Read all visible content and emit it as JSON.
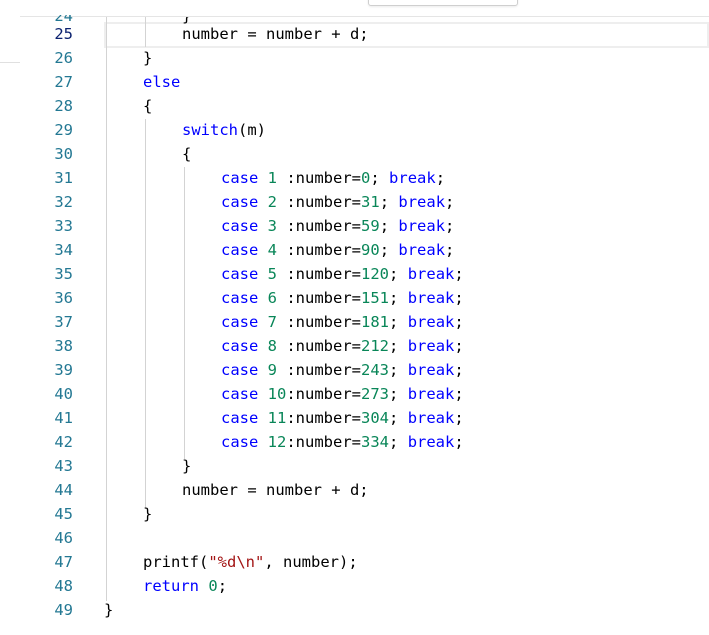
{
  "editor": {
    "line_numbers": [
      "25",
      "26",
      "27",
      "28",
      "29",
      "30",
      "31",
      "32",
      "33",
      "34",
      "35",
      "36",
      "37",
      "38",
      "39",
      "40",
      "41",
      "42",
      "43",
      "44",
      "45",
      "46",
      "47",
      "48",
      "49"
    ],
    "active_line": "25",
    "partial_top": {
      "line_number": "24",
      "brace": "}"
    },
    "code": {
      "l25": "number = number + d;",
      "l26": "}",
      "l27_kw": "else",
      "l28": "{",
      "l29_kw": "switch",
      "l29_rest": "(m)",
      "l30": "{",
      "cases": [
        {
          "kw": "case",
          "num": "1",
          "sep": " :number=",
          "val": "0",
          "end": ";",
          "brk": "break",
          "semi": ";"
        },
        {
          "kw": "case",
          "num": "2",
          "sep": " :number=",
          "val": "31",
          "end": ";",
          "brk": "break",
          "semi": ";"
        },
        {
          "kw": "case",
          "num": "3",
          "sep": " :number=",
          "val": "59",
          "end": ";",
          "brk": "break",
          "semi": ";"
        },
        {
          "kw": "case",
          "num": "4",
          "sep": " :number=",
          "val": "90",
          "end": ";",
          "brk": "break",
          "semi": ";"
        },
        {
          "kw": "case",
          "num": "5",
          "sep": " :number=",
          "val": "120",
          "end": ";",
          "brk": "break",
          "semi": ";"
        },
        {
          "kw": "case",
          "num": "6",
          "sep": " :number=",
          "val": "151",
          "end": ";",
          "brk": "break",
          "semi": ";"
        },
        {
          "kw": "case",
          "num": "7",
          "sep": " :number=",
          "val": "181",
          "end": ";",
          "brk": "break",
          "semi": ";"
        },
        {
          "kw": "case",
          "num": "8",
          "sep": " :number=",
          "val": "212",
          "end": ";",
          "brk": "break",
          "semi": ";"
        },
        {
          "kw": "case",
          "num": "9",
          "sep": " :number=",
          "val": "243",
          "end": ";",
          "brk": "break",
          "semi": ";"
        },
        {
          "kw": "case",
          "num": "10",
          "sep": ":number=",
          "val": "273",
          "end": ";",
          "brk": "break",
          "semi": ";"
        },
        {
          "kw": "case",
          "num": "11",
          "sep": ":number=",
          "val": "304",
          "end": ";",
          "brk": "break",
          "semi": ";"
        },
        {
          "kw": "case",
          "num": "12",
          "sep": ":number=",
          "val": "334",
          "end": ";",
          "brk": "break",
          "semi": ";"
        }
      ],
      "l43": "}",
      "l44": "number = number + d;",
      "l45": "}",
      "l47_fn": "printf(",
      "l47_str": "\"%d\\n\"",
      "l47_rest": ", number);",
      "l48_kw": "return",
      "l48_num": "0",
      "l48_end": ";",
      "l49": "}"
    }
  }
}
